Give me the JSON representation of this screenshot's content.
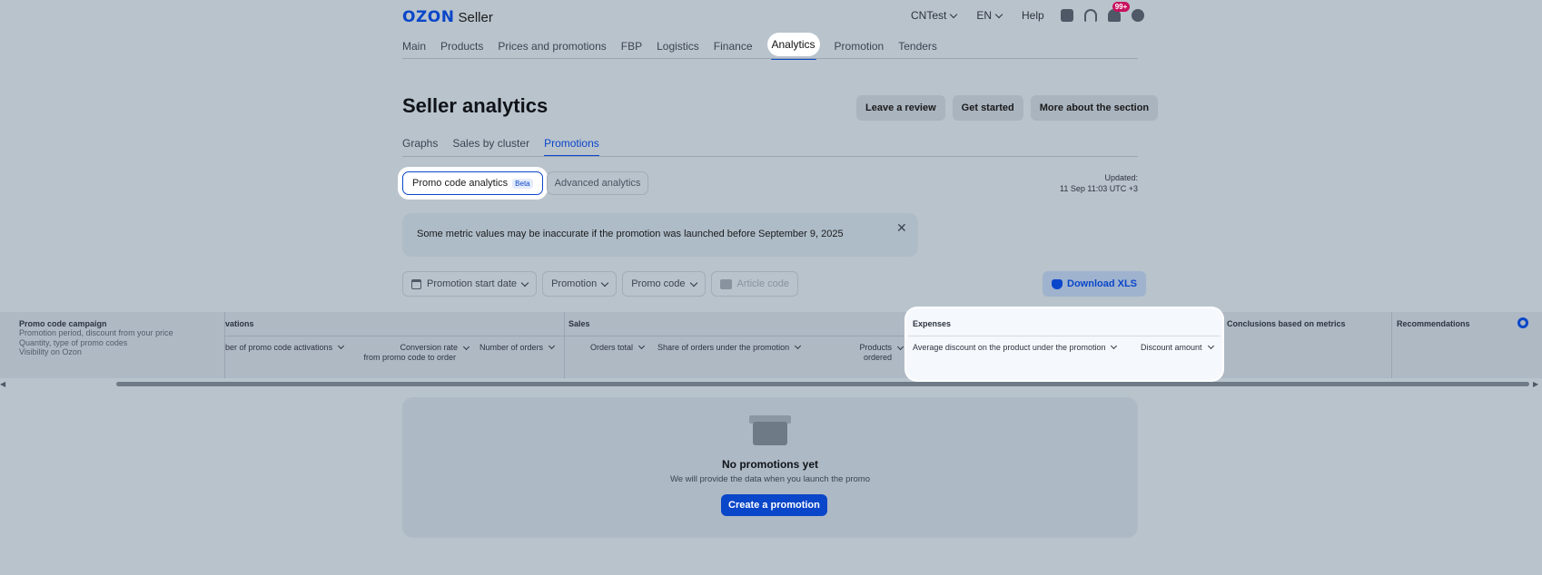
{
  "header": {
    "logo_brand": "OZON",
    "logo_suffix": "Seller",
    "account": "CNTest",
    "language": "EN",
    "help": "Help",
    "notifications_badge": "99+"
  },
  "nav": {
    "items": [
      "Main",
      "Products",
      "Prices and promotions",
      "FBP",
      "Logistics",
      "Finance",
      "Analytics",
      "Promotion",
      "Tenders"
    ],
    "active": "Analytics"
  },
  "page": {
    "title": "Seller analytics",
    "buttons": {
      "review": "Leave a review",
      "started": "Get started",
      "more": "More about the section"
    }
  },
  "subtabs": {
    "graphs": "Graphs",
    "cluster": "Sales by cluster",
    "promotions": "Promotions",
    "active": "Promotions"
  },
  "segment": {
    "promo": "Promo code analytics",
    "beta": "Beta",
    "advanced": "Advanced analytics"
  },
  "updated": {
    "label": "Updated:",
    "value": "11 Sep 11:03 UTC +3"
  },
  "banner": {
    "text": "Some metric values may be inaccurate if the promotion was launched before September 9, 2025"
  },
  "filters": {
    "start_date": "Promotion start date",
    "promotion": "Promotion",
    "promo_code": "Promo code",
    "article": "Article code",
    "download": "Download XLS"
  },
  "table": {
    "campaign": {
      "title": "Promo code campaign",
      "lines": [
        "Promotion period, discount from your price",
        "Quantity, type of promo codes",
        "Visibility on Ozon"
      ]
    },
    "activations": {
      "title": "vations",
      "col1": "ber of promo code activations",
      "col2_line1": "Conversion rate",
      "col2_line2": "from promo code to order",
      "col3": "Number of orders"
    },
    "sales": {
      "title": "Sales",
      "col1": "Orders total",
      "col2": "Share of orders under the promotion",
      "col3_line1": "Products",
      "col3_line2": "ordered"
    },
    "expenses": {
      "title": "Expenses",
      "col1": "Average discount on the product under the promotion",
      "col2": "Discount amount"
    },
    "conclusions": {
      "title": "Conclusions based on metrics"
    },
    "recommendations": {
      "title": "Recommendations"
    }
  },
  "empty": {
    "title": "No promotions yet",
    "subtitle": "We will provide the data when you launch the promo",
    "button": "Create a promotion"
  }
}
